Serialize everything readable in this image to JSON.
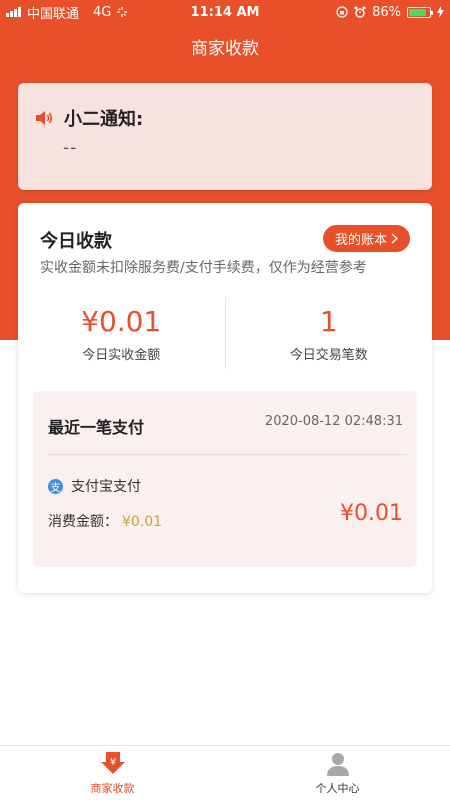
{
  "status_bar": {
    "carrier": "中国联通",
    "network": "4G",
    "time": "11:14 AM",
    "battery": "86%",
    "battery_level": 0.86
  },
  "nav": {
    "title": "商家收款"
  },
  "notice": {
    "title": "小二通知:",
    "body": "--"
  },
  "today": {
    "title": "今日收款",
    "ledger_button": "我的账本",
    "note": "实收金额未扣除服务费/支付手续费，仅作为经营参考",
    "stats": [
      {
        "value": "¥0.01",
        "label": "今日实收金额"
      },
      {
        "value": "1",
        "label": "今日交易笔数"
      }
    ]
  },
  "last_payment": {
    "title": "最近一笔支付",
    "time": "2020-08-12 02:48:31",
    "method": "支付宝支付",
    "method_icon_char": "支",
    "amount_label": "消费金额：",
    "amount_value": "¥0.01",
    "amount_big": "¥0.01"
  },
  "tabbar": [
    {
      "label": "商家收款",
      "icon": "yuan-arrow-icon",
      "active": true
    },
    {
      "label": "个人中心",
      "icon": "person-icon",
      "active": false
    }
  ],
  "colors": {
    "accent": "#e8502a",
    "notice_bg": "#f8e2df",
    "highlight_bg": "#fcefef",
    "gold": "#c9a53a"
  }
}
